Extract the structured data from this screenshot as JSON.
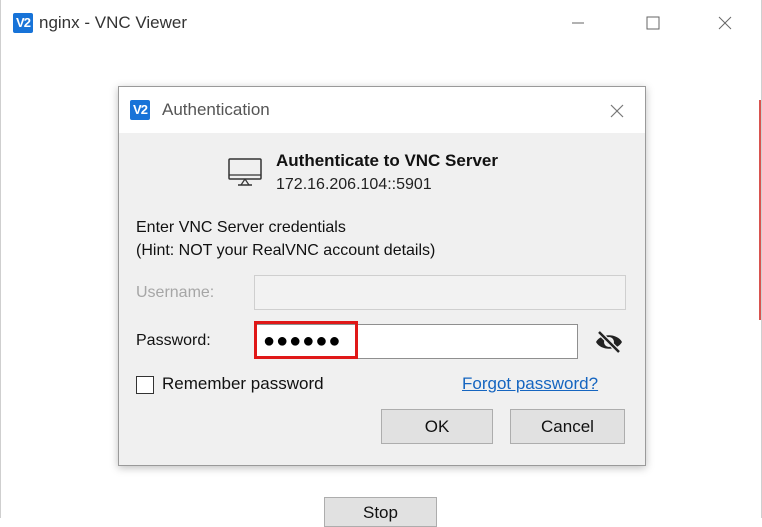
{
  "app": {
    "logo_text": "V2",
    "window_title": "nginx - VNC Viewer",
    "stop_label": "Stop"
  },
  "dialog": {
    "logo_text": "V2",
    "title": "Authentication",
    "heading": "Authenticate to VNC Server",
    "server_address": "172.16.206.104::5901",
    "prompt_line1": "Enter VNC Server credentials",
    "prompt_line2": "(Hint: NOT your RealVNC account details)",
    "username_label": "Username:",
    "username_value": "",
    "password_label": "Password:",
    "password_masked": "●●●●●●",
    "remember_label": "Remember password",
    "remember_checked": false,
    "forgot_link": "Forgot password?",
    "ok_label": "OK",
    "cancel_label": "Cancel"
  },
  "icons": {
    "monitor": "monitor-icon",
    "eye_toggle": "eye-slash-icon",
    "minimize": "minimize-icon",
    "maximize": "maximize-icon",
    "close": "close-icon"
  },
  "colors": {
    "logo": "#1773d8",
    "link": "#1565c0",
    "highlight": "#e01818",
    "dialog_bg": "#f0f0f0"
  }
}
